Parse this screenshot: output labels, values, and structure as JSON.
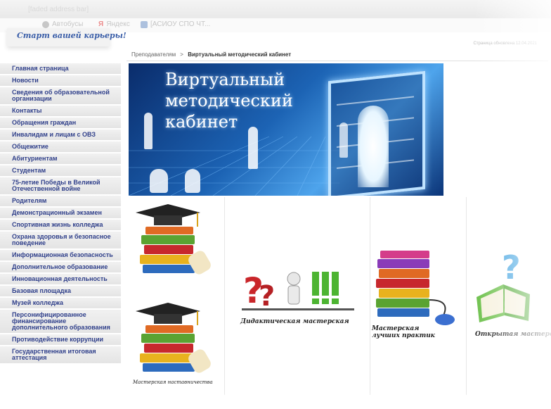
{
  "browser": {
    "url": "[faded address bar]",
    "bookmarks": [
      {
        "label": "Автобусы",
        "icon": "globe-icon"
      },
      {
        "label": "Яндекс",
        "icon": "yandex-icon"
      },
      {
        "label": "[АСИОУ СПО ЧТ...",
        "icon": "page-icon"
      }
    ]
  },
  "site": {
    "logo_text": "Старт вашей карьеры!",
    "updated": "Страница обновлена 12.04.2021"
  },
  "breadcrumb": {
    "parent": "Преподавателям",
    "separator": ">",
    "current": "Виртуальный методический кабинет"
  },
  "sidebar": {
    "items": [
      {
        "label": "Главная страница"
      },
      {
        "label": "Новости"
      },
      {
        "label": "Сведения об образовательной организации"
      },
      {
        "label": "Контакты"
      },
      {
        "label": "Обращения граждан"
      },
      {
        "label": "Инвалидам и лицам с ОВЗ"
      },
      {
        "label": "Общежитие"
      },
      {
        "label": "Абитуриентам"
      },
      {
        "label": "Студентам"
      },
      {
        "label": "75-летие Победы в Великой Отечественной войне"
      },
      {
        "label": "Родителям"
      },
      {
        "label": "Демонстрационный экзамен"
      },
      {
        "label": "Спортивная жизнь колледжа"
      },
      {
        "label": "Охрана здоровья и безопасное поведение"
      },
      {
        "label": "Информационная безопасность"
      },
      {
        "label": "Дополнительное образование"
      },
      {
        "label": "Инновационная деятельность"
      },
      {
        "label": "Базовая площадка"
      },
      {
        "label": "Музей колледжа"
      },
      {
        "label": "Персонифицированное финансирование дополнительного образования"
      },
      {
        "label": "Противодействие коррупции"
      },
      {
        "label": "Государственная итоговая аттестация"
      }
    ]
  },
  "banner": {
    "line1": "Виртуальный",
    "line2": "методический",
    "line3": "кабинет"
  },
  "cards": [
    {
      "caption": "Мастерская наставничества",
      "icon": "graduation-books-icon"
    },
    {
      "caption": "Дидактическая мастерская",
      "icon": "question-exclamation-icon"
    },
    {
      "caption_l1": "Мастерская",
      "caption_l2": "лучших практик",
      "icon": "books-mouse-icon"
    },
    {
      "caption": "Открытая мастерская",
      "icon": "book-question-icon"
    }
  ],
  "colors": {
    "sidebar_text": "#2f3f8a",
    "banner_dark": "#0a2c6b",
    "banner_light": "#4ea4ec"
  }
}
